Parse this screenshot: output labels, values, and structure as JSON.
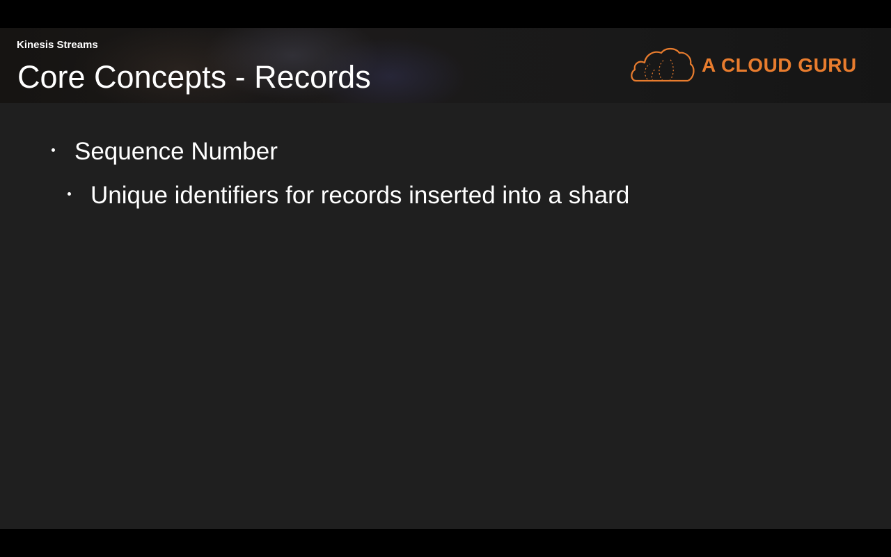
{
  "header": {
    "section_label": "Kinesis Streams",
    "title": "Core Concepts - Records"
  },
  "logo": {
    "text": "A CLOUD GURU",
    "icon": "cloud-icon",
    "color": "#e87c2e"
  },
  "content": {
    "bullets": [
      {
        "level": 1,
        "text": "Sequence Number"
      },
      {
        "level": 2,
        "text": "Unique identifiers for records inserted into a shard"
      }
    ]
  },
  "colors": {
    "slide_background": "#1f1f1f",
    "text": "#ffffff",
    "accent": "#e87c2e"
  }
}
